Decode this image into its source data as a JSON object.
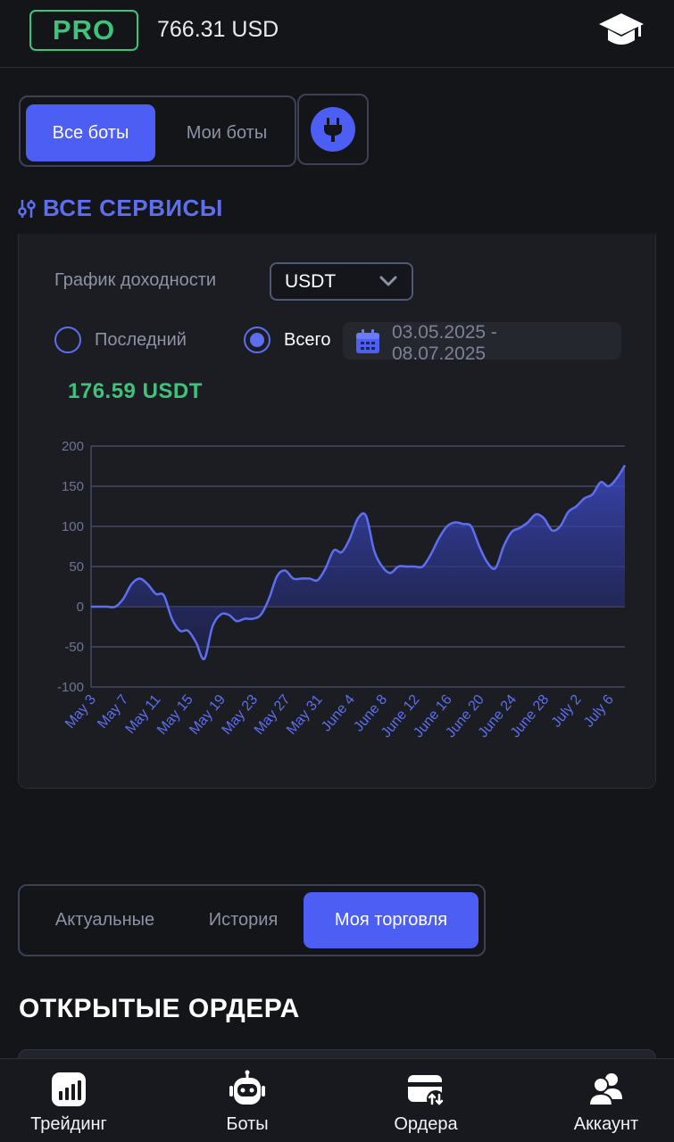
{
  "header": {
    "pro_label": "PRO",
    "balance": "766.31 USD"
  },
  "bot_tabs": [
    {
      "label": "Все боты",
      "active": true
    },
    {
      "label": "Мои боты",
      "active": false
    }
  ],
  "section_title": "ВСЕ СЕРВИСЫ",
  "profit": {
    "label": "График доходности",
    "currency_selected": "USDT",
    "radio_last": "Последний",
    "radio_all": "Всего",
    "radio_selected": "all",
    "date_range": "03.05.2025 -\n08.07.2025",
    "total": "176.59 USDT"
  },
  "chart_data": {
    "type": "area",
    "title": "",
    "xlabel": "",
    "ylabel": "",
    "ylim": [
      -100,
      200
    ],
    "yticks": [
      200,
      150,
      100,
      50,
      0,
      -50,
      -100
    ],
    "grid": true,
    "xticks": [
      "May 3",
      "May 7",
      "May 11",
      "May 15",
      "May 19",
      "May 23",
      "May 27",
      "May 31",
      "June 4",
      "June 8",
      "June 12",
      "June 16",
      "June 20",
      "June 24",
      "June 28",
      "July 2",
      "July 6"
    ],
    "x": [
      "May 3",
      "May 4",
      "May 5",
      "May 6",
      "May 7",
      "May 8",
      "May 9",
      "May 10",
      "May 11",
      "May 12",
      "May 13",
      "May 14",
      "May 15",
      "May 16",
      "May 17",
      "May 18",
      "May 19",
      "May 20",
      "May 21",
      "May 22",
      "May 23",
      "May 24",
      "May 25",
      "May 26",
      "May 27",
      "May 28",
      "May 29",
      "May 30",
      "May 31",
      "June 1",
      "June 2",
      "June 3",
      "June 4",
      "June 5",
      "June 6",
      "June 7",
      "June 8",
      "June 9",
      "June 10",
      "June 11",
      "June 12",
      "June 13",
      "June 14",
      "June 15",
      "June 16",
      "June 17",
      "June 18",
      "June 19",
      "June 20",
      "June 21",
      "June 22",
      "June 23",
      "June 24",
      "June 25",
      "June 26",
      "June 27",
      "June 28",
      "June 29",
      "June 30",
      "July 1",
      "July 2",
      "July 3",
      "July 4",
      "July 5",
      "July 6",
      "July 7",
      "July 8"
    ],
    "values": [
      0,
      0,
      0,
      0,
      10,
      28,
      35,
      28,
      16,
      14,
      -15,
      -30,
      -30,
      -45,
      -65,
      -25,
      -10,
      -10,
      -18,
      -15,
      -15,
      -10,
      10,
      38,
      45,
      35,
      35,
      35,
      33,
      48,
      70,
      68,
      85,
      110,
      113,
      70,
      50,
      42,
      50,
      50,
      50,
      50,
      65,
      85,
      100,
      105,
      103,
      100,
      75,
      55,
      48,
      75,
      93,
      98,
      105,
      115,
      110,
      95,
      100,
      118,
      125,
      135,
      140,
      155,
      150,
      160,
      176
    ]
  },
  "trade_tabs": [
    {
      "label": "Актуальные",
      "active": false
    },
    {
      "label": "История",
      "active": false
    },
    {
      "label": "Моя торговля",
      "active": true
    }
  ],
  "orders_title": "ОТКРЫТЫЕ ОРДЕРА",
  "nav": [
    {
      "label": "Трейдинг",
      "icon": "chart-icon"
    },
    {
      "label": "Боты",
      "icon": "robot-icon"
    },
    {
      "label": "Ордера",
      "icon": "orders-icon"
    },
    {
      "label": "Аккаунт",
      "icon": "account-icon"
    }
  ],
  "colors": {
    "accent": "#4c5ef3",
    "green": "#3ec47a",
    "background": "#141519",
    "line": "#5d6ff0"
  }
}
